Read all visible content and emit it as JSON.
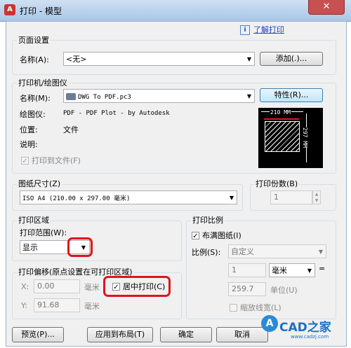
{
  "window": {
    "title": "打印 - 模型",
    "close": "✕"
  },
  "help": {
    "icon": "i",
    "link": "了解打印"
  },
  "page_setup": {
    "group": "页面设置",
    "name_label": "名称(A):",
    "name_value": "<无>",
    "add_button": "添加(.)..."
  },
  "printer": {
    "group": "打印机/绘图仪",
    "name_label": "名称(M):",
    "name_value": "DWG To PDF.pc3",
    "properties_button": "特性(R)...",
    "plotter_label": "绘图仪:",
    "plotter_value": "PDF - PDF Plot - by Autodesk",
    "location_label": "位置:",
    "location_value": "文件",
    "description_label": "说明:",
    "print_to_file": "打印到文件(F)",
    "preview": {
      "width": "210 MM",
      "height": "297 MM"
    }
  },
  "paper_size": {
    "group": "图纸尺寸(Z)",
    "value": "ISO A4 (210.00 x 297.00 毫米)"
  },
  "copies": {
    "group": "打印份数(B)",
    "value": "1"
  },
  "plot_area": {
    "group": "打印区域",
    "range_label": "打印范围(W):",
    "range_value": "显示"
  },
  "plot_offset": {
    "group": "打印偏移(原点设置在可打印区域)",
    "x_label": "X:",
    "x_value": "0.00",
    "x_unit": "毫米",
    "y_label": "Y:",
    "y_value": "91.68",
    "y_unit": "毫米",
    "center_plot": "居中打印(C)"
  },
  "plot_scale": {
    "group": "打印比例",
    "fit_to_paper": "布满图纸(I)",
    "scale_label": "比例(S):",
    "scale_value": "自定义",
    "value1": "1",
    "unit_value": "毫米",
    "equals": "=",
    "value2": "259.7",
    "unit_label": "单位(U)",
    "scale_lineweights": "缩放线宽(L)"
  },
  "buttons": {
    "preview": "预览(P)...",
    "apply_layout": "应用到布局(T)",
    "ok": "确定",
    "cancel": "取消"
  },
  "watermark": {
    "text": "CAD之家",
    "sub": "www.cadzj.com"
  },
  "colors": {
    "highlight": "#e0141c",
    "title_bar": "#a9c6e6",
    "link": "#1f3fbf"
  }
}
